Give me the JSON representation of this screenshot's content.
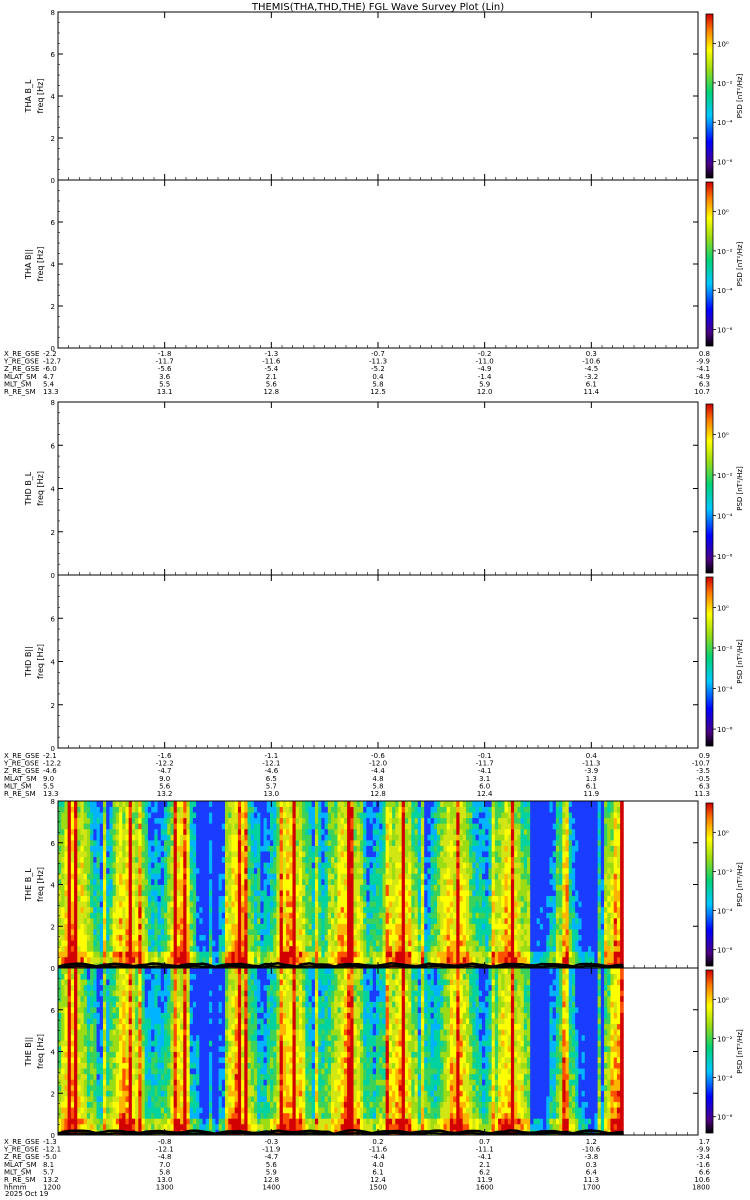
{
  "title": "THEMIS(THA,THD,THE) FGL Wave Survey Plot (Lin)",
  "date_label": "2025 Oct 19",
  "colorbar_label": "PSD [nT²/Hz]",
  "colorbar_ticks": [
    "10⁰",
    "10⁻²",
    "10⁻⁴",
    "10⁻⁶"
  ],
  "chart_data": [
    {
      "type": "heatmap",
      "probe": "THA",
      "component": "B_L",
      "ylabel_top": "THA B_L",
      "ylabel": "freq [Hz]",
      "ylim": [
        0,
        8
      ],
      "yticks": [
        0,
        2,
        4,
        6,
        8
      ],
      "has_data": false
    },
    {
      "type": "heatmap",
      "probe": "THA",
      "component": "B||",
      "ylabel_top": "THA B||",
      "ylabel": "freq [Hz]",
      "ylim": [
        0,
        8
      ],
      "yticks": [
        0,
        2,
        4,
        6
      ],
      "has_data": false
    },
    {
      "type": "heatmap",
      "probe": "THD",
      "component": "B_L",
      "ylabel_top": "THD B_L",
      "ylabel": "freq [Hz]",
      "ylim": [
        0,
        8
      ],
      "yticks": [
        0,
        2,
        4,
        6,
        8
      ],
      "has_data": false
    },
    {
      "type": "heatmap",
      "probe": "THD",
      "component": "B||",
      "ylabel_top": "THD B||",
      "ylabel": "freq [Hz]",
      "ylim": [
        0,
        8
      ],
      "yticks": [
        0,
        2,
        4,
        6
      ],
      "has_data": false
    },
    {
      "type": "heatmap",
      "probe": "THE",
      "component": "B_L",
      "ylabel_top": "THE B_L",
      "ylabel": "freq [Hz]",
      "ylim": [
        0,
        8
      ],
      "yticks": [
        0,
        2,
        4,
        6,
        8
      ],
      "has_data": true,
      "data_xrange": [
        1200,
        1730
      ]
    },
    {
      "type": "heatmap",
      "probe": "THE",
      "component": "B||",
      "ylabel_top": "THE B||",
      "ylabel": "freq [Hz]",
      "ylim": [
        0,
        8
      ],
      "yticks": [
        0,
        2,
        4,
        6
      ],
      "has_data": true,
      "data_xrange": [
        1200,
        1730
      ]
    }
  ],
  "ephem_blocks": [
    {
      "labels": [
        "X_RE_GSE",
        "Y_RE_GSE",
        "Z_RE_GSE",
        "MLAT_SM",
        "MLT_SM",
        "R_RE_SM"
      ],
      "rows": [
        [
          "-2.2",
          "-1.8",
          "-1.3",
          "-0.7",
          "-0.2",
          "0.3",
          "0.8"
        ],
        [
          "-12.7",
          "-11.7",
          "-11.6",
          "-11.3",
          "-11.0",
          "-10.6",
          "-9.9"
        ],
        [
          "-6.0",
          "-5.6",
          "-5.4",
          "-5.2",
          "-4.9",
          "-4.5",
          "-4.1"
        ],
        [
          "4.7",
          "3.6",
          "2.1",
          "0.4",
          "-1.4",
          "-3.2",
          "-4.9"
        ],
        [
          "5.4",
          "5.5",
          "5.6",
          "5.8",
          "5.9",
          "6.1",
          "6.3"
        ],
        [
          "13.3",
          "13.1",
          "12.8",
          "12.5",
          "12.0",
          "11.4",
          "10.7"
        ]
      ]
    },
    {
      "labels": [
        "X_RE_GSE",
        "Y_RE_GSE",
        "Z_RE_GSE",
        "MLAT_SM",
        "MLT_SM",
        "R_RE_SM"
      ],
      "rows": [
        [
          "-2.1",
          "-1.6",
          "-1.1",
          "-0.6",
          "-0.1",
          "0.4",
          "0.9"
        ],
        [
          "-12.2",
          "-12.2",
          "-12.1",
          "-12.0",
          "-11.7",
          "-11.3",
          "-10.7"
        ],
        [
          "-4.6",
          "-4.7",
          "-4.6",
          "-4.4",
          "-4.1",
          "-3.9",
          "-3.5"
        ],
        [
          "9.0",
          "9.0",
          "6.5",
          "4.8",
          "3.1",
          "1.3",
          "-0.5"
        ],
        [
          "5.5",
          "5.6",
          "5.7",
          "5.8",
          "6.0",
          "6.1",
          "6.3"
        ],
        [
          "13.3",
          "13.2",
          "13.0",
          "12.8",
          "12.4",
          "11.9",
          "11.3"
        ]
      ]
    },
    {
      "labels": [
        "X_RE_GSE",
        "Y_RE_GSE",
        "Z_RE_GSE",
        "MLAT_SM",
        "MLT_SM",
        "R_RE_SM",
        "hhmm"
      ],
      "rows": [
        [
          "-1.3",
          "-0.8",
          "-0.3",
          "0.2",
          "0.7",
          "1.2",
          "1.7"
        ],
        [
          "-12.1",
          "-12.1",
          "-11.9",
          "-11.6",
          "-11.1",
          "-10.6",
          "-9.9"
        ],
        [
          "-5.0",
          "-4.8",
          "-4.7",
          "-4.4",
          "-4.1",
          "-3.8",
          "-3.4"
        ],
        [
          "8.1",
          "7.0",
          "5.6",
          "4.0",
          "2.1",
          "0.3",
          "-1.6"
        ],
        [
          "5.7",
          "5.8",
          "5.9",
          "6.1",
          "6.2",
          "6.4",
          "6.6"
        ],
        [
          "13.2",
          "13.0",
          "12.8",
          "12.4",
          "11.9",
          "11.3",
          "10.6"
        ],
        [
          "1200",
          "1300",
          "1400",
          "1500",
          "1600",
          "1700",
          "1800"
        ]
      ]
    }
  ]
}
